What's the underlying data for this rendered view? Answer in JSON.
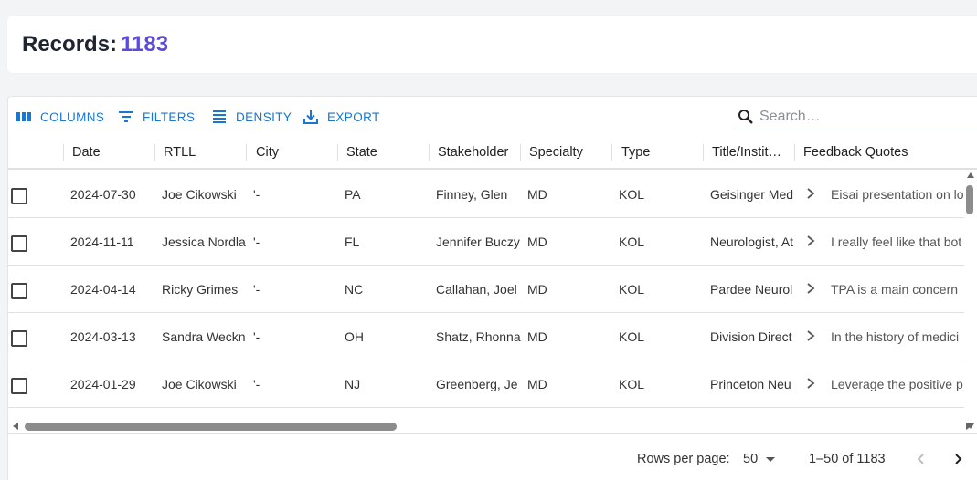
{
  "records": {
    "label": "Records:",
    "count": "1183"
  },
  "toolbar": {
    "columns_label": "COLUMNS",
    "filters_label": "FILTERS",
    "density_label": "DENSITY",
    "export_label": "EXPORT",
    "icons": [
      "view-column-icon",
      "filter-list-icon",
      "density-icon",
      "export-download-icon"
    ],
    "accent_color": "#1976d2"
  },
  "search": {
    "placeholder": "Search…",
    "value": ""
  },
  "columns": [
    "Date",
    "RTLL",
    "City",
    "State",
    "Stakeholder",
    "Specialty",
    "Type",
    "Title/Instit…",
    "Feedback Quotes"
  ],
  "rows": [
    {
      "date": "2024-07-30",
      "rtll": "Joe Cikowski",
      "city": "'-",
      "state": "PA",
      "stakeholder": "Finney, Glen",
      "specialty": "MD",
      "type": "KOL",
      "title": "Geisinger Med",
      "quote": "Eisai presentation on lo"
    },
    {
      "date": "2024-11-11",
      "rtll": "Jessica Nordla",
      "city": "'-",
      "state": "FL",
      "stakeholder": "Jennifer Buczy",
      "specialty": "MD",
      "type": "KOL",
      "title": "Neurologist, At",
      "quote": "I really feel like that bot"
    },
    {
      "date": "2024-04-14",
      "rtll": "Ricky Grimes",
      "city": "'-",
      "state": "NC",
      "stakeholder": "Callahan, Joel",
      "specialty": "MD",
      "type": "KOL",
      "title": "Pardee Neurol",
      "quote": "TPA is a main concern"
    },
    {
      "date": "2024-03-13",
      "rtll": "Sandra Weckn",
      "city": "'-",
      "state": "OH",
      "stakeholder": "Shatz, Rhonna",
      "specialty": "MD",
      "type": "KOL",
      "title": "Division Direct",
      "quote": "In the history of medici"
    },
    {
      "date": "2024-01-29",
      "rtll": "Joe Cikowski",
      "city": "'-",
      "state": "NJ",
      "stakeholder": "Greenberg, Je",
      "specialty": "MD",
      "type": "KOL",
      "title": "Princeton Neu",
      "quote": "Leverage the positive p"
    }
  ],
  "pagination": {
    "rows_per_page_label": "Rows per page:",
    "rows_per_page_value": "50",
    "range_text": "1–50 of 1183"
  },
  "colors": {
    "count_accent": "#5b4bd6"
  }
}
